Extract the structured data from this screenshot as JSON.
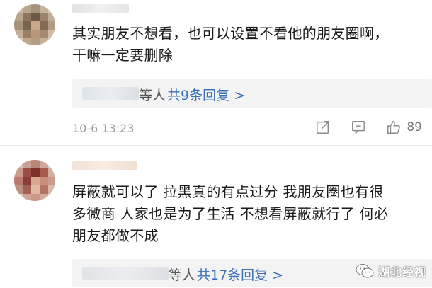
{
  "comments": [
    {
      "text_line1": "其实朋友不想看，也可以设置不看他的朋友圈啊，",
      "text_line2": "干嘛一定要删除",
      "reply_suffix": "等人",
      "reply_link": "共9条回复 >",
      "time": "10-6 13:23",
      "likes": "89"
    },
    {
      "text_line1": "屏蔽就可以了 拉黑真的有点过分 我朋友圈也有很",
      "text_line2": "多微商 人家也是为了生活 不想看屏蔽就行了 何必",
      "text_line3": "朋友都做不成",
      "reply_suffix": "等人",
      "reply_link": "共17条回复 >"
    }
  ],
  "watermark": {
    "text": "湖北经视"
  },
  "icons": {
    "share": "share-icon",
    "comment": "comment-icon",
    "like": "thumbs-up-icon"
  },
  "colors": {
    "link": "#3b6fb6",
    "reply_bg": "#f3f3f3",
    "meta": "#9a9a9a"
  }
}
